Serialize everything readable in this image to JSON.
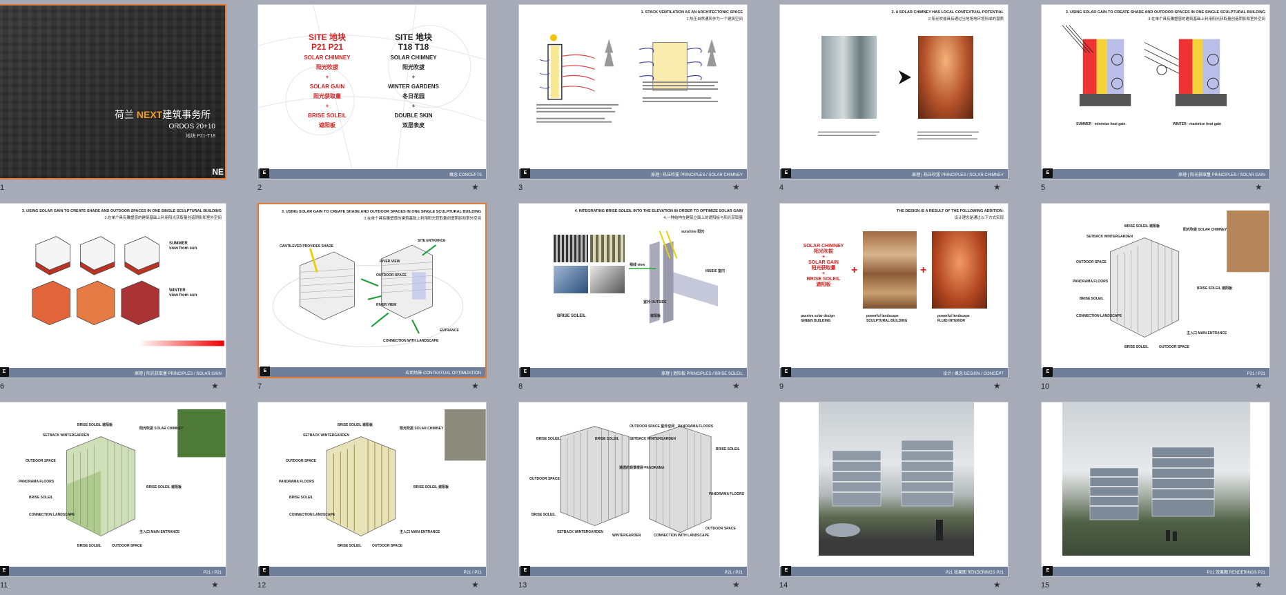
{
  "slides": [
    {
      "num": "1",
      "selected": true,
      "title_cn_pre": "荷兰",
      "title_brand": "NEXT",
      "title_cn_post": "建筑事务所",
      "subtitle": "ORDOS 20+10",
      "subtitle2": "地块 P21-T18",
      "corner": "NE"
    },
    {
      "num": "2",
      "selected": false,
      "site_left": "SITE  地块",
      "site_left2": "P21   P21",
      "left_items": [
        "SOLAR CHIMNEY",
        "阳光吹拔",
        "+",
        "SOLAR GAIN",
        "阳光获取量",
        "+",
        "BRISE SOLEIL",
        "遮阳板"
      ],
      "site_right": "SITE   地块",
      "site_right2": "T18   T18",
      "right_items": [
        "SOLAR CHIMNEY",
        "阳光吹拔",
        "+",
        "WINTER GARDENS",
        "冬日花园",
        "+",
        "DOUBLE SKIN",
        "双层表皮"
      ],
      "footer": "概念  CONCEPTS"
    },
    {
      "num": "3",
      "selected": false,
      "title": "1. STACK VENTILATION AS AN ARCHITECTONIC SPACE",
      "title2": "1.热压自然通风作为一个建筑空间",
      "footer": "原理 | 热压吹拔    PRINCIPLES / SOLAR CHIMNEY"
    },
    {
      "num": "4",
      "selected": false,
      "title": "2. A SOLAR CHIMNEY HAS LOCAL CONTEXTUAL POTENTIAL",
      "title2": "2.阳光吹拔具有通过当地场地环境形成的潜质",
      "footer": "原理 | 热压吹拔    PRINCIPLES / SOLAR CHIMNEY"
    },
    {
      "num": "5",
      "selected": false,
      "title": "3. USING SOLAR GAIN TO CREATE SHADE AND OUTDOOR SPACES IN ONE SINGLE SCULPTURAL BUILDING",
      "title2": "3.在单个具有雕塑感的建筑基础上利用阳光获取量创造阴影和室外空间",
      "label_summer": "SUMMER - minimize heat gain",
      "label_winter": "WINTER - maximize heat gain",
      "footer": "原理 | 阳光获取量    PRINCIPLES / SOLAR GAIN"
    },
    {
      "num": "6",
      "selected": false,
      "title": "3. USING SOLAR GAIN TO CREATE SHADE AND OUTDOOR SPACES IN ONE SINGLE SCULPTURAL BUILDING",
      "title2": "3.在单个具有雕塑感的建筑基础上利用阳光获取量创造阴影和室外空间",
      "summer": "SUMMER",
      "summer2": "view from sun",
      "winter": "WINTER",
      "winter2": "view from sun",
      "footer": "原理 | 阳光获取量    PRINCIPLES / SOLAR GAIN"
    },
    {
      "num": "7",
      "selected": true,
      "title": "3. USING SOLAR GAIN TO CREATE SHADE AND OUTDOOR SPACES IN ONE SINGLE SCULPTURAL BUILDING",
      "title2": "3.在单个具有雕塑感的建筑基础上利用阳光获取量创造阴影和室外空间",
      "labels": [
        "CANTILEVER PROVIDES SHADE",
        "SITE ENTRANCE",
        "RIVER VIEW",
        "OUTDOOR SPACE",
        "RIVER VIEW",
        "CONNECTION WITH LANDSCAPE",
        "ENTRANCE"
      ],
      "footer": "应用场景    CONTEXTUAL OPTIMIZATION"
    },
    {
      "num": "8",
      "selected": false,
      "title": "4. INTEGRATING BRISE SOLEIL INTO THE ELEVATION IN ORDER TO OPTIMIZE SOLAR GAIN",
      "title2": "4.一种结构在建筑立面上的遮阳板与阳光获取量",
      "labels": [
        "sunshine 阳光",
        "视线 view",
        "INSIDE 室内",
        "室外 OUTSIDE",
        "BRISE SOLEIL",
        "遮阳板"
      ],
      "footer": "原理 | 遮阳板    PRINCIPLES / BRISE SOLEIL"
    },
    {
      "num": "9",
      "selected": false,
      "title": "THE DESIGN IS A RESULT OF THE FOLLOWING ADDITION:",
      "title2": "设计理念是通过以下方式实现",
      "left_items": [
        "SOLAR CHIMNEY",
        "阳光吹拔",
        "+",
        "SOLAR GAIN",
        "阳光获取量",
        "+",
        "BRISE SOLEIL",
        "遮阳板"
      ],
      "captions": [
        "passive solar design",
        "powerful landscape",
        "powerful landscape"
      ],
      "captions2": [
        "GREEN BUILDING",
        "SCULPTURAL BUILDING",
        "FLUID INTERIOR"
      ],
      "footer": "设计 | 概念    DESIGN / CONCEPT"
    },
    {
      "num": "10",
      "selected": false,
      "labels": [
        "BRISE SOLEIL 遮阳板",
        "阳光吹拔 SOLAR CHIMNEY",
        "SETBACK WINTERGARDEN",
        "OUTDOOR SPACE",
        "PANORAMA FLOORS",
        "BRISE SOLEIL",
        "CONNECTION LANDSCAPE",
        "BRISE SOLEIL",
        "OUTDOOR SPACE",
        "主入口 MAIN ENTRANCE",
        "BRISE SOLEIL 遮阳板"
      ],
      "footer": "P21 / P21"
    },
    {
      "num": "11",
      "selected": false,
      "labels": [
        "BRISE SOLEIL 遮阳板",
        "阳光吹拔 SOLAR CHIMNEY",
        "SETBACK WINTERGARDEN",
        "OUTDOOR SPACE",
        "PANORAMA FLOORS",
        "BRISE SOLEIL",
        "CONNECTION LANDSCAPE",
        "BRISE SOLEIL",
        "OUTDOOR SPACE",
        "主入口 MAIN ENTRANCE",
        "BRISE SOLEIL 遮阳板"
      ],
      "footer": "P21 / P21"
    },
    {
      "num": "12",
      "selected": false,
      "labels": [
        "BRISE SOLEIL 遮阳板",
        "阳光吹拔 SOLAR CHIMNEY",
        "SETBACK WINTERGARDEN",
        "OUTDOOR SPACE",
        "PANORAMA FLOORS",
        "BRISE SOLEIL",
        "CONNECTION LANDSCAPE",
        "BRISE SOLEIL",
        "OUTDOOR SPACE",
        "主入口 MAIN ENTRANCE",
        "BRISE SOLEIL 遮阳板"
      ],
      "footer": "P21 / P21"
    },
    {
      "num": "13",
      "selected": false,
      "labels": [
        "OUTDOOR SPACE 室外空间",
        "PANORAMA FLOORS",
        "BRISE SOLEIL",
        "BRISE SOLEIL",
        "SETBACK WINTERGARDEN",
        "通透的观景楼层 PANORAMA",
        "OUTDOOR SPACE",
        "BRISE SOLEIL",
        "SETBACK WINTERGARDEN",
        "WINTERGARDEN",
        "CONNECTION WITH LANDSCAPE",
        "OUTDOOR SPACE",
        "BRISE SOLEIL",
        "PANORAMA FLOORS"
      ],
      "footer": "P21 / P21"
    },
    {
      "num": "14",
      "selected": false,
      "footer": "P21  效果图    RENDERINGS P21"
    },
    {
      "num": "15",
      "selected": false,
      "footer": "P21  效果图    RENDERINGS P21"
    }
  ],
  "colors": {
    "accent_orange": "#e4782e",
    "red_text": "#d32020",
    "footer_blue": "#6f7f9a",
    "background": "#a7abb8"
  }
}
